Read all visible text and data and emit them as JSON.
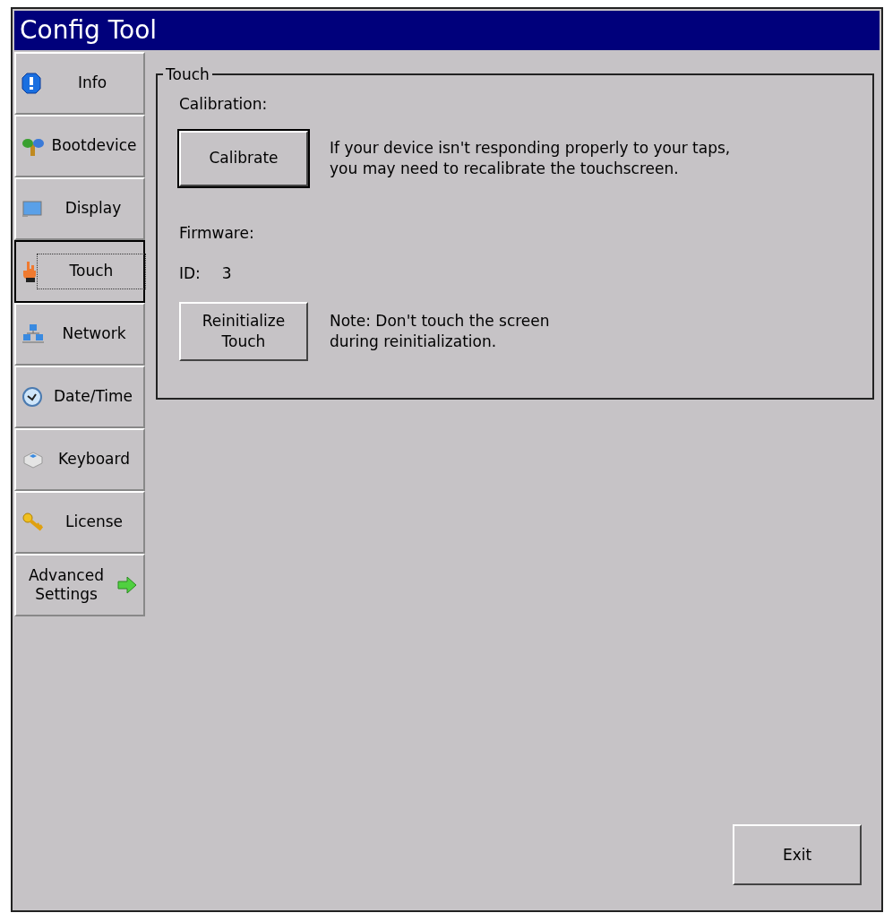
{
  "window": {
    "title": "Config Tool"
  },
  "sidebar": {
    "items": [
      {
        "label": "Info",
        "kind": "page",
        "selected": false
      },
      {
        "label": "Bootdevice",
        "kind": "page",
        "selected": false
      },
      {
        "label": "Display",
        "kind": "page",
        "selected": false
      },
      {
        "label": "Touch",
        "kind": "page",
        "selected": true
      },
      {
        "label": "Network",
        "kind": "page",
        "selected": false
      },
      {
        "label": "Date/Time",
        "kind": "page",
        "selected": false
      },
      {
        "label": "Keyboard",
        "kind": "page",
        "selected": false
      },
      {
        "label": "License",
        "kind": "page",
        "selected": false
      },
      {
        "label": "Advanced\nSettings",
        "kind": "more",
        "selected": false
      }
    ]
  },
  "group": {
    "title": "Touch",
    "calibration_label": "Calibration:",
    "calibrate_button": "Calibrate",
    "calibrate_note": "If your device isn't responding properly to your taps,\nyou may need to recalibrate the touchscreen.",
    "firmware_label": "Firmware:",
    "id_label": "ID:",
    "id_value": "3",
    "reinit_button": "Reinitialize\nTouch",
    "reinit_note": "Note: Don't touch the screen\nduring reinitialization."
  },
  "buttons": {
    "exit": "Exit"
  }
}
